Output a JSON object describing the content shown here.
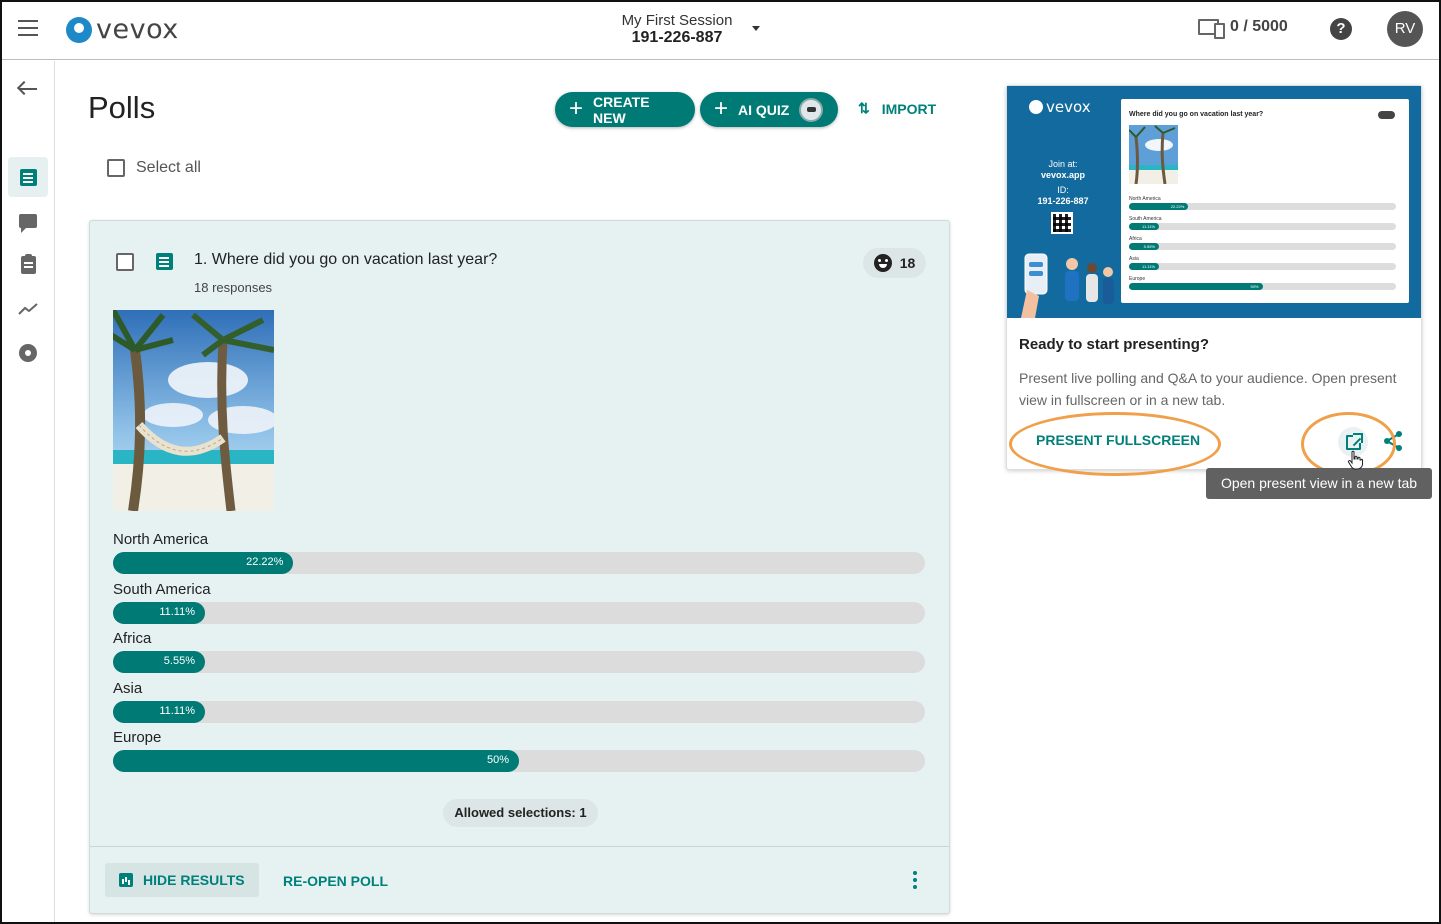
{
  "header": {
    "logo_text": "vevox",
    "session_name": "My First Session",
    "session_id": "191-226-887",
    "device_count": "0 / 5000",
    "help_label": "?",
    "avatar_initials": "RV"
  },
  "main": {
    "title": "Polls",
    "create_new_label": "CREATE NEW",
    "ai_quiz_label": "AI QUIZ",
    "import_label": "IMPORT",
    "select_all_label": "Select all"
  },
  "poll": {
    "question": "1. Where did you go on vacation last year?",
    "responses": "18 responses",
    "participant_count": "18",
    "results": [
      {
        "label": "North America",
        "pct_text": "22.22%",
        "value": 22.22
      },
      {
        "label": "South America",
        "pct_text": "11.11%",
        "value": 11.11
      },
      {
        "label": "Africa",
        "pct_text": "5.55%",
        "value": 5.55
      },
      {
        "label": "Asia",
        "pct_text": "11.11%",
        "value": 11.11
      },
      {
        "label": "Europe",
        "pct_text": "50%",
        "value": 50
      }
    ],
    "allowed_selections": "Allowed selections: 1",
    "hide_results_label": "HIDE RESULTS",
    "reopen_label": "RE-OPEN POLL"
  },
  "preview": {
    "logo_text": "vevox",
    "join_at_label": "Join at:",
    "join_url": "vevox.app",
    "id_label": "ID:",
    "session_id": "191-226-887",
    "question": "Where did you go on vacation last year?",
    "results": [
      {
        "label": "North America",
        "pct_text": "22.22%",
        "value": 22.22
      },
      {
        "label": "South America",
        "pct_text": "11.11%",
        "value": 11.11
      },
      {
        "label": "Africa",
        "pct_text": "5.55%",
        "value": 5.55
      },
      {
        "label": "Asia",
        "pct_text": "11.11%",
        "value": 11.11
      },
      {
        "label": "Europe",
        "pct_text": "50%",
        "value": 50
      }
    ]
  },
  "present": {
    "title": "Ready to start presenting?",
    "description": "Present live polling and Q&A to your audience. Open present view in fullscreen or in a new tab.",
    "fullscreen_label": "PRESENT FULLSCREEN",
    "tooltip": "Open present view in a new tab"
  },
  "colors": {
    "accent": "#007a75",
    "highlight_ring": "#f0a04b",
    "preview_bg": "#136a9e"
  }
}
